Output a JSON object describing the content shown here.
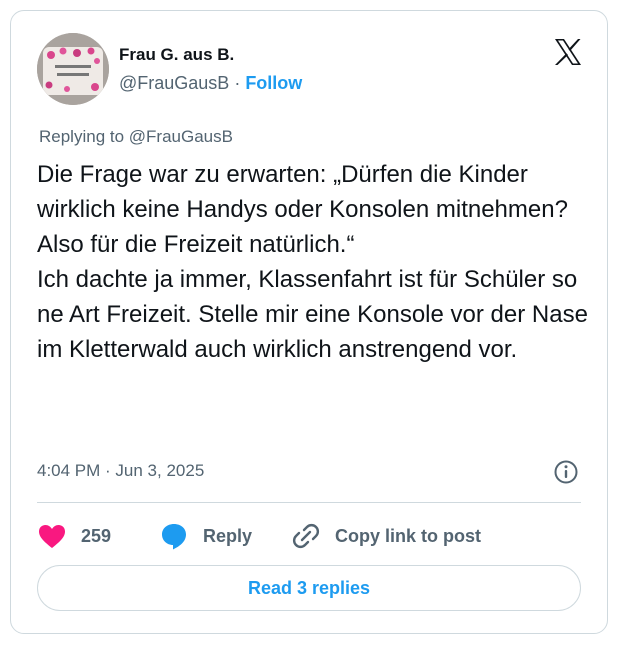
{
  "author": {
    "display_name": "Frau G. aus B.",
    "handle": "@FrauGausB",
    "separator": " · ",
    "follow_label": "Follow",
    "avatar_icon": "mug-photo-avatar"
  },
  "reply_context": {
    "text": "Replying to @FrauGausB"
  },
  "tweet": {
    "text": "Die Frage war zu erwarten: „Dürfen die Kinder wirklich keine Handys oder Konsolen mitnehmen? Also für die Freizeit natürlich.“\nIch dachte ja immer, Klassenfahrt ist für Schüler so ne Art Freizeit. Stelle mir eine Konsole vor der Nase im Kletterwald auch wirklich anstrengend vor.",
    "timestamp": "4:04 PM · Jun 3, 2025"
  },
  "actions": {
    "like_count": "259",
    "reply_label": "Reply",
    "copy_link_label": "Copy link to post"
  },
  "footer": {
    "read_replies_label": "Read 3 replies"
  },
  "colors": {
    "accent": "#1d9bf0",
    "like": "#f91880",
    "muted": "#536471",
    "text": "#0f1419",
    "border": "#cfd9de"
  },
  "icons": [
    "x-logo-icon",
    "info-icon",
    "heart-icon",
    "reply-bubble-icon",
    "link-icon"
  ]
}
